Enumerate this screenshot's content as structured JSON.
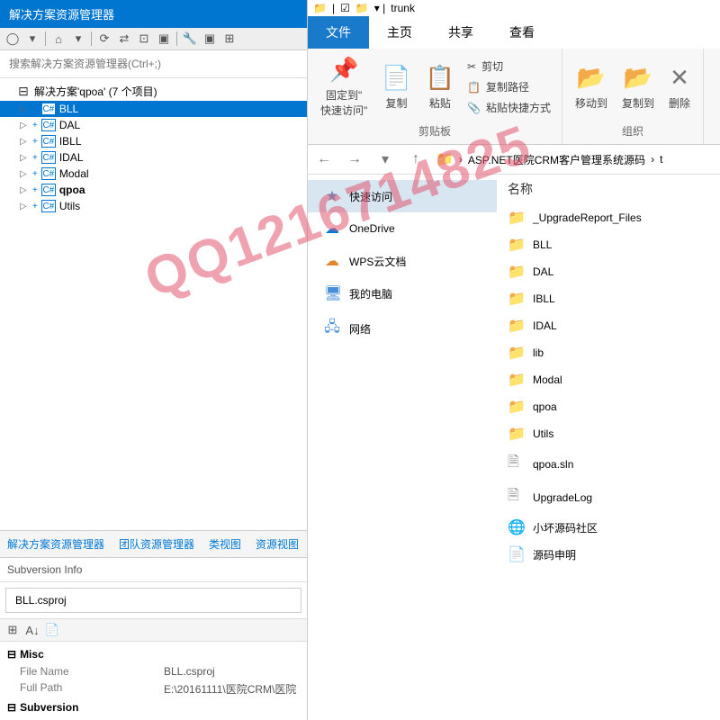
{
  "watermark": "QQ1216714825",
  "vs": {
    "title": "解决方案资源管理器",
    "search_placeholder": "搜索解决方案资源管理器(Ctrl+;)",
    "solution_label": "解决方案'qpoa' (7 个项目)",
    "projects": [
      "BLL",
      "DAL",
      "IBLL",
      "IDAL",
      "Modal",
      "qpoa",
      "Utils"
    ],
    "selected_project": "BLL",
    "bold_project": "qpoa",
    "tabs": [
      "解决方案资源管理器",
      "团队资源管理器",
      "类视图",
      "资源视图"
    ],
    "sub_info_title": "Subversion Info",
    "sub_file": "BLL.csproj",
    "props": {
      "misc_header": "Misc",
      "file_name_key": "File Name",
      "file_name_val": "BLL.csproj",
      "full_path_key": "Full Path",
      "full_path_val": "E:\\20161111\\医院CRM\\医院",
      "subversion_header": "Subversion"
    }
  },
  "explorer": {
    "window_title": "trunk",
    "ribbon_tabs": {
      "file": "文件",
      "home": "主页",
      "share": "共享",
      "view": "查看"
    },
    "ribbon": {
      "pin": "固定到\"\n快速访问\"",
      "copy": "复制",
      "paste": "粘贴",
      "cut": "剪切",
      "copy_path": "复制路径",
      "paste_shortcut": "粘贴快捷方式",
      "move_to": "移动到",
      "copy_to": "复制到",
      "delete": "删除",
      "clipboard_group": "剪贴板",
      "organize_group": "组织"
    },
    "breadcrumb": [
      "ASP.NET医院CRM客户管理系统源码",
      "t"
    ],
    "sidebar": [
      {
        "label": "快速访问",
        "icon": "★",
        "color": "#3da2e0",
        "selected": true
      },
      {
        "label": "OneDrive",
        "icon": "☁",
        "color": "#0078d4"
      },
      {
        "label": "WPS云文档",
        "icon": "☁",
        "color": "#e0862e"
      },
      {
        "label": "我的电脑",
        "icon": "🖥",
        "color": "#4a90d9"
      },
      {
        "label": "网络",
        "icon": "🖧",
        "color": "#4a90d9"
      }
    ],
    "column_header": "名称",
    "files": [
      {
        "name": "_UpgradeReport_Files",
        "type": "folder"
      },
      {
        "name": "BLL",
        "type": "folder"
      },
      {
        "name": "DAL",
        "type": "folder"
      },
      {
        "name": "IBLL",
        "type": "folder"
      },
      {
        "name": "IDAL",
        "type": "folder"
      },
      {
        "name": "lib",
        "type": "folder"
      },
      {
        "name": "Modal",
        "type": "folder"
      },
      {
        "name": "qpoa",
        "type": "folder"
      },
      {
        "name": "Utils",
        "type": "folder"
      },
      {
        "name": "qpoa.sln",
        "type": "file"
      },
      {
        "name": "UpgradeLog",
        "type": "file"
      },
      {
        "name": "小坏源码社区",
        "type": "link"
      },
      {
        "name": "源码申明",
        "type": "text"
      }
    ]
  }
}
